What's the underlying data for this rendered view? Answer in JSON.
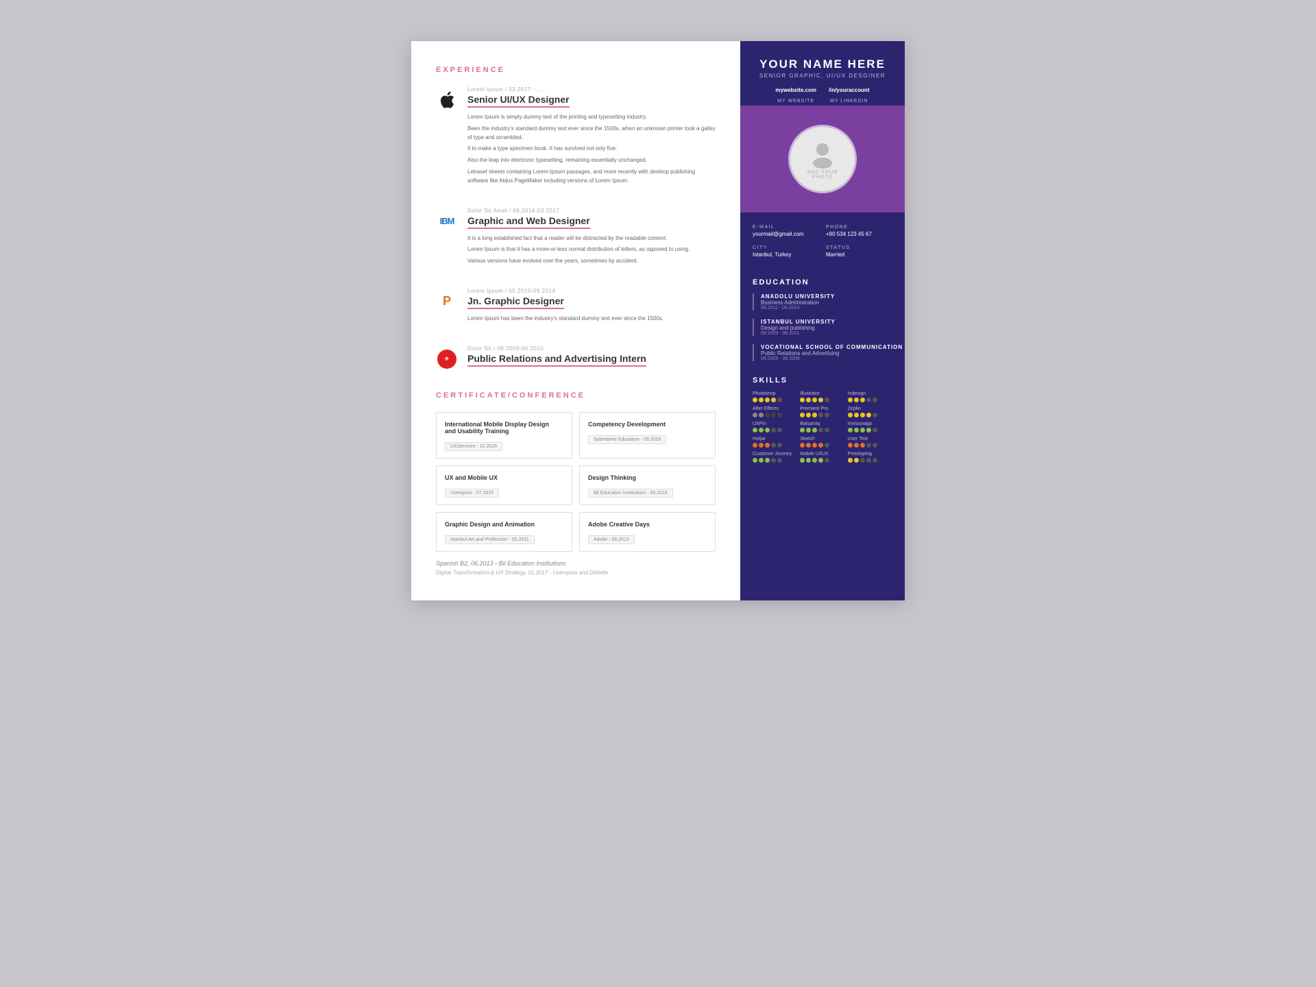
{
  "right": {
    "name": "YOUR NAME HERE",
    "title": "SENIOR GRAPHIC, UI/UX DESGINER",
    "links": [
      {
        "url": "mywebsite.com",
        "label": "MY WEBSITE"
      },
      {
        "url": "/in/youraccount",
        "label": "MY LINKEDIN"
      }
    ],
    "photo_label": "ADD YOUR\nPHOTO",
    "contact": [
      {
        "label": "E-MAIL",
        "value": "yourmail@gmail.com"
      },
      {
        "label": "PHONE",
        "value": "+90 534 123 45 67"
      },
      {
        "label": "CITY",
        "value": "Istanbul, Turkey"
      },
      {
        "label": "STATUS",
        "value": "Married"
      }
    ],
    "education_title": "EDUCATION",
    "education": [
      {
        "school": "ANADOLU UNIVERSITY",
        "degree": "Business Administration",
        "years": "09.2011 - 06.2014"
      },
      {
        "school": "ISTANBUL UNIVERSITY",
        "degree": "Design and publishing",
        "years": "09.2009 - 06.2011"
      },
      {
        "school": "VOCATIONAL SCHOOL OF COMMUNICATION",
        "degree": "Public Relations and Advertising",
        "years": "09.2005 - 06.2009"
      }
    ],
    "skills_title": "SKILLS",
    "skills": [
      {
        "name": "Photoshop",
        "filled": 4,
        "total": 5,
        "color": "yellow"
      },
      {
        "name": "Illustrator",
        "filled": 4,
        "total": 5,
        "color": "yellow"
      },
      {
        "name": "Indesign",
        "filled": 3,
        "total": 5,
        "color": "yellow"
      },
      {
        "name": "After Effects",
        "filled": 2,
        "total": 5,
        "color": "gray"
      },
      {
        "name": "Premiere Pro",
        "filled": 3,
        "total": 5,
        "color": "yellow"
      },
      {
        "name": "Zeplin",
        "filled": 4,
        "total": 5,
        "color": "yellow"
      },
      {
        "name": "UXPin",
        "filled": 3,
        "total": 5,
        "color": "green"
      },
      {
        "name": "Balsamiq",
        "filled": 3,
        "total": 5,
        "color": "green"
      },
      {
        "name": "Invisionapp",
        "filled": 4,
        "total": 5,
        "color": "green"
      },
      {
        "name": "Hotjar",
        "filled": 3,
        "total": 5,
        "color": "orange"
      },
      {
        "name": "Sketch",
        "filled": 4,
        "total": 5,
        "color": "orange"
      },
      {
        "name": "User Test",
        "filled": 3,
        "total": 5,
        "color": "orange"
      },
      {
        "name": "Customer Journey",
        "filled": 3,
        "total": 5,
        "color": "green"
      },
      {
        "name": "Mobile UI/UX",
        "filled": 4,
        "total": 5,
        "color": "green"
      },
      {
        "name": "Prototyping",
        "filled": 2,
        "total": 5,
        "color": "yellow"
      }
    ]
  },
  "left": {
    "experience_title": "EXPERIENCE",
    "experiences": [
      {
        "meta": "Lorem Ipsum / 03.2017 - ...",
        "title": "Senior UI/UX Designer",
        "logo": "apple",
        "descriptions": [
          "Lorem Ipsum is simply dummy text of the printing and typesetting industry.",
          "Been the industry's standard dummy text ever since the 1500s, when an unknown printer took a galley of type and scrambled.",
          "It to make a type specimen book. It has survived not only five.",
          "Also the leap into electronic typesetting, remaining essentially unchanged.",
          "Letraset sheets containing Lorem Ipsum passages, and more recently with desktop publishing software like Aldus PageMaker including versions of Lorem Ipsum."
        ]
      },
      {
        "meta": "Dolor Sit Amet / 09.2014-03.2017",
        "title": "Graphic and Web Designer",
        "logo": "ibm",
        "descriptions": [
          "It is a long established fact that a reader will be distracted by the readable content.",
          "Lorem Ipsum is that it has a more-or-less normal distribution of letters, as opposed to using.",
          "Various versions have evolved over the years, sometimes by accident."
        ]
      },
      {
        "meta": "Lorem Ipsum / 05.2010-09.2014",
        "title": "Jn. Graphic Designer",
        "logo": "p",
        "descriptions": [
          "Lorem Ipsum has been the industry's standard dummy text ever since the 1500s."
        ]
      },
      {
        "meta": "Dolor Sit / 09.2009-05.2010",
        "title": "Public Relations and Advertising Intern",
        "logo": "ta",
        "descriptions": []
      }
    ],
    "cert_title": "CERTIFICATE/CONFERENCE",
    "certs": [
      {
        "name": "International Mobile Display Design\nand Usability Training",
        "badge": "UXServices - 10.2016"
      },
      {
        "name": "Competency Development",
        "badge": "Submarine Education - 05.2016"
      },
      {
        "name": "UX and Mobile UX",
        "badge": "Userspots - 07.2015"
      },
      {
        "name": "Design Thinking",
        "badge": "Bil Education Institutions - 05.2016"
      },
      {
        "name": "Graphic Design and Animation",
        "badge": "Istanbul Art and Profession - 05.2011"
      },
      {
        "name": "Adobe Creative Days",
        "badge": "Adobe - 06.2013"
      }
    ],
    "language_line": "Spanish B2, 06.2013",
    "language_institution": "Bil Education Institutions",
    "digital_line": "Digital Transformation & UX Strategy, 01.2017 - Userspots and Deloitte"
  }
}
